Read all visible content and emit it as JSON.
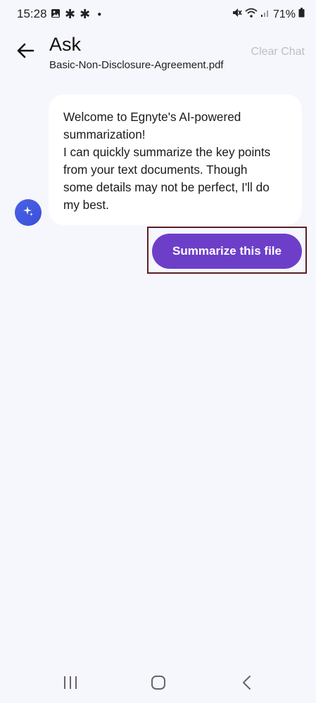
{
  "status_bar": {
    "time": "15:28",
    "left_icons": [
      "gallery-icon",
      "asterisk-icon",
      "asterisk-icon",
      "dot-icon"
    ],
    "right_icons": [
      "mute-icon",
      "wifi-icon",
      "signal-icon"
    ],
    "battery": "71%"
  },
  "header": {
    "title": "Ask",
    "subtitle": "Basic-Non-Disclosure-Agreement.pdf",
    "clear_chat": "Clear Chat"
  },
  "chat": {
    "message": "Welcome to Egnyte's AI-powered\nsummarization!\nI can quickly summarize the key points\nfrom your text documents. Though\nsome details may not be perfect, I'll do\nmy best.",
    "avatar_icon": "sparkle-icon"
  },
  "actions": {
    "summarize_label": "Summarize this file"
  },
  "colors": {
    "background": "#f6f6fd",
    "bubble": "#ffffff",
    "primary_button": "#6d3fc9",
    "avatar": "#4a5ee0",
    "clear_chat_text": "#bdbdc4",
    "highlight_border": "#5a1f22"
  },
  "nav_bar": {
    "icons": [
      "recents-icon",
      "home-icon",
      "back-nav-icon"
    ]
  }
}
